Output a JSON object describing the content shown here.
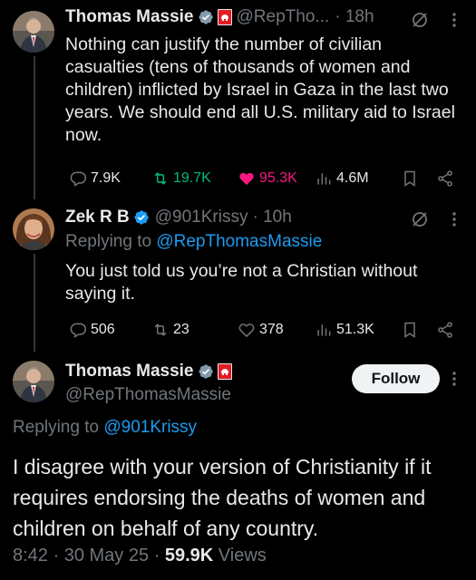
{
  "colors": {
    "background": "#000000",
    "text": "#e7e9ea",
    "muted": "#71767b",
    "link": "#1d9bf0",
    "like_active": "#f91880",
    "verified": "#1d9bf0"
  },
  "tweet1": {
    "name": "Thomas Massie",
    "handle": "@RepTho...",
    "time": "· 18h",
    "text": "Nothing can justify the number of civilian casualties (tens of thousands of women and children)  inflicted by Israel in Gaza in the last two years. We should end all U.S. military aid to Israel now.",
    "stats": {
      "replies": "7.9K",
      "reposts": "19.7K",
      "likes": "95.3K",
      "views": "4.6M"
    },
    "liked": true,
    "icons": [
      "grok-icon",
      "more-icon",
      "reply-icon",
      "repost-icon",
      "heart-icon",
      "views-icon",
      "bookmark-icon",
      "share-icon"
    ]
  },
  "tweet2": {
    "name": "Zek R B",
    "handle": "@901Krissy",
    "time": "· 10h",
    "replying_prefix": "Replying to ",
    "replying_to": "@RepThomasMassie",
    "text": "You just told us you’re not a Christian without saying it.",
    "stats": {
      "replies": "506",
      "reposts": "23",
      "likes": "378",
      "views": "51.3K"
    }
  },
  "tweet3": {
    "name": "Thomas Massie",
    "handle": "@RepThomasMassie",
    "follow_label": "Follow",
    "replying_prefix": "Replying to ",
    "replying_to": "@901Krissy",
    "text": "I disagree with your version of Christianity if it requires endorsing the deaths of women and children on behalf of any country.",
    "time": "8:42 · 30 May 25 · ",
    "views_count": "59.9K",
    "views_label": " Views"
  }
}
